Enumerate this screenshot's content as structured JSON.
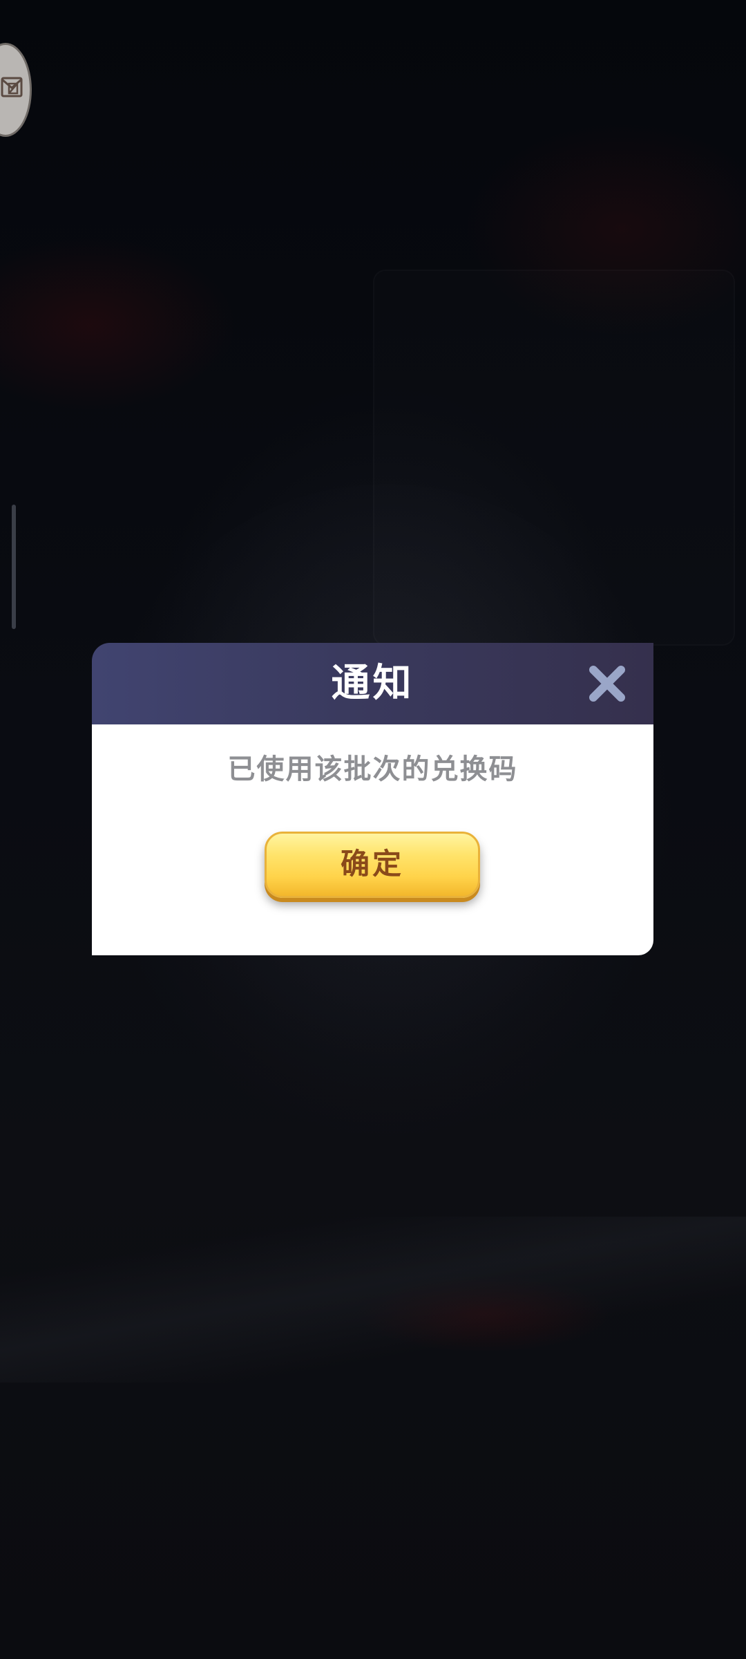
{
  "dialog": {
    "title": "通知",
    "message": "已使用该批次的兑换码",
    "confirm_label": "确定"
  },
  "icons": {
    "close": "close-icon",
    "mail": "mail-icon"
  },
  "colors": {
    "header_gradient_start": "#414470",
    "header_gradient_end": "#35304d",
    "confirm_button": "#ffd34a",
    "confirm_text": "#8a4a1a",
    "message_text": "#8e8f93"
  }
}
